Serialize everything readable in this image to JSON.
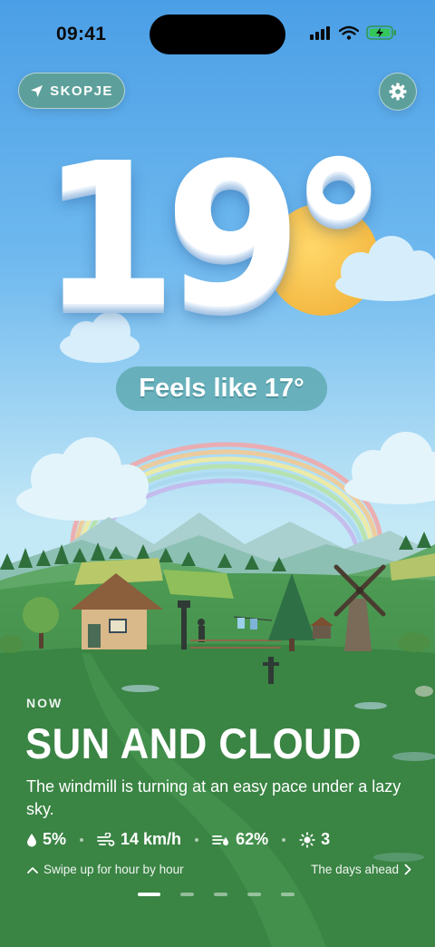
{
  "status_bar": {
    "time": "09:41"
  },
  "header": {
    "location": "SKOPJE"
  },
  "weather": {
    "temperature": "19°",
    "feels_like": "Feels like 17°",
    "now_label": "NOW",
    "condition": "SUN AND CLOUD",
    "description": "The windmill is turning at an easy pace under a lazy sky.",
    "stats": {
      "precipitation": "5%",
      "wind": "14 km/h",
      "humidity": "62%",
      "uv_index": "3"
    }
  },
  "footer": {
    "swipe_hint": "Swipe up for hour by hour",
    "days_link": "The days ahead",
    "pages_total": 5,
    "page_active": 1
  },
  "colors": {
    "sky_top": "#4fa3e8",
    "sky_bottom": "#bfe6f5",
    "grass": "#3f8a4a",
    "pill": "#5da094"
  }
}
